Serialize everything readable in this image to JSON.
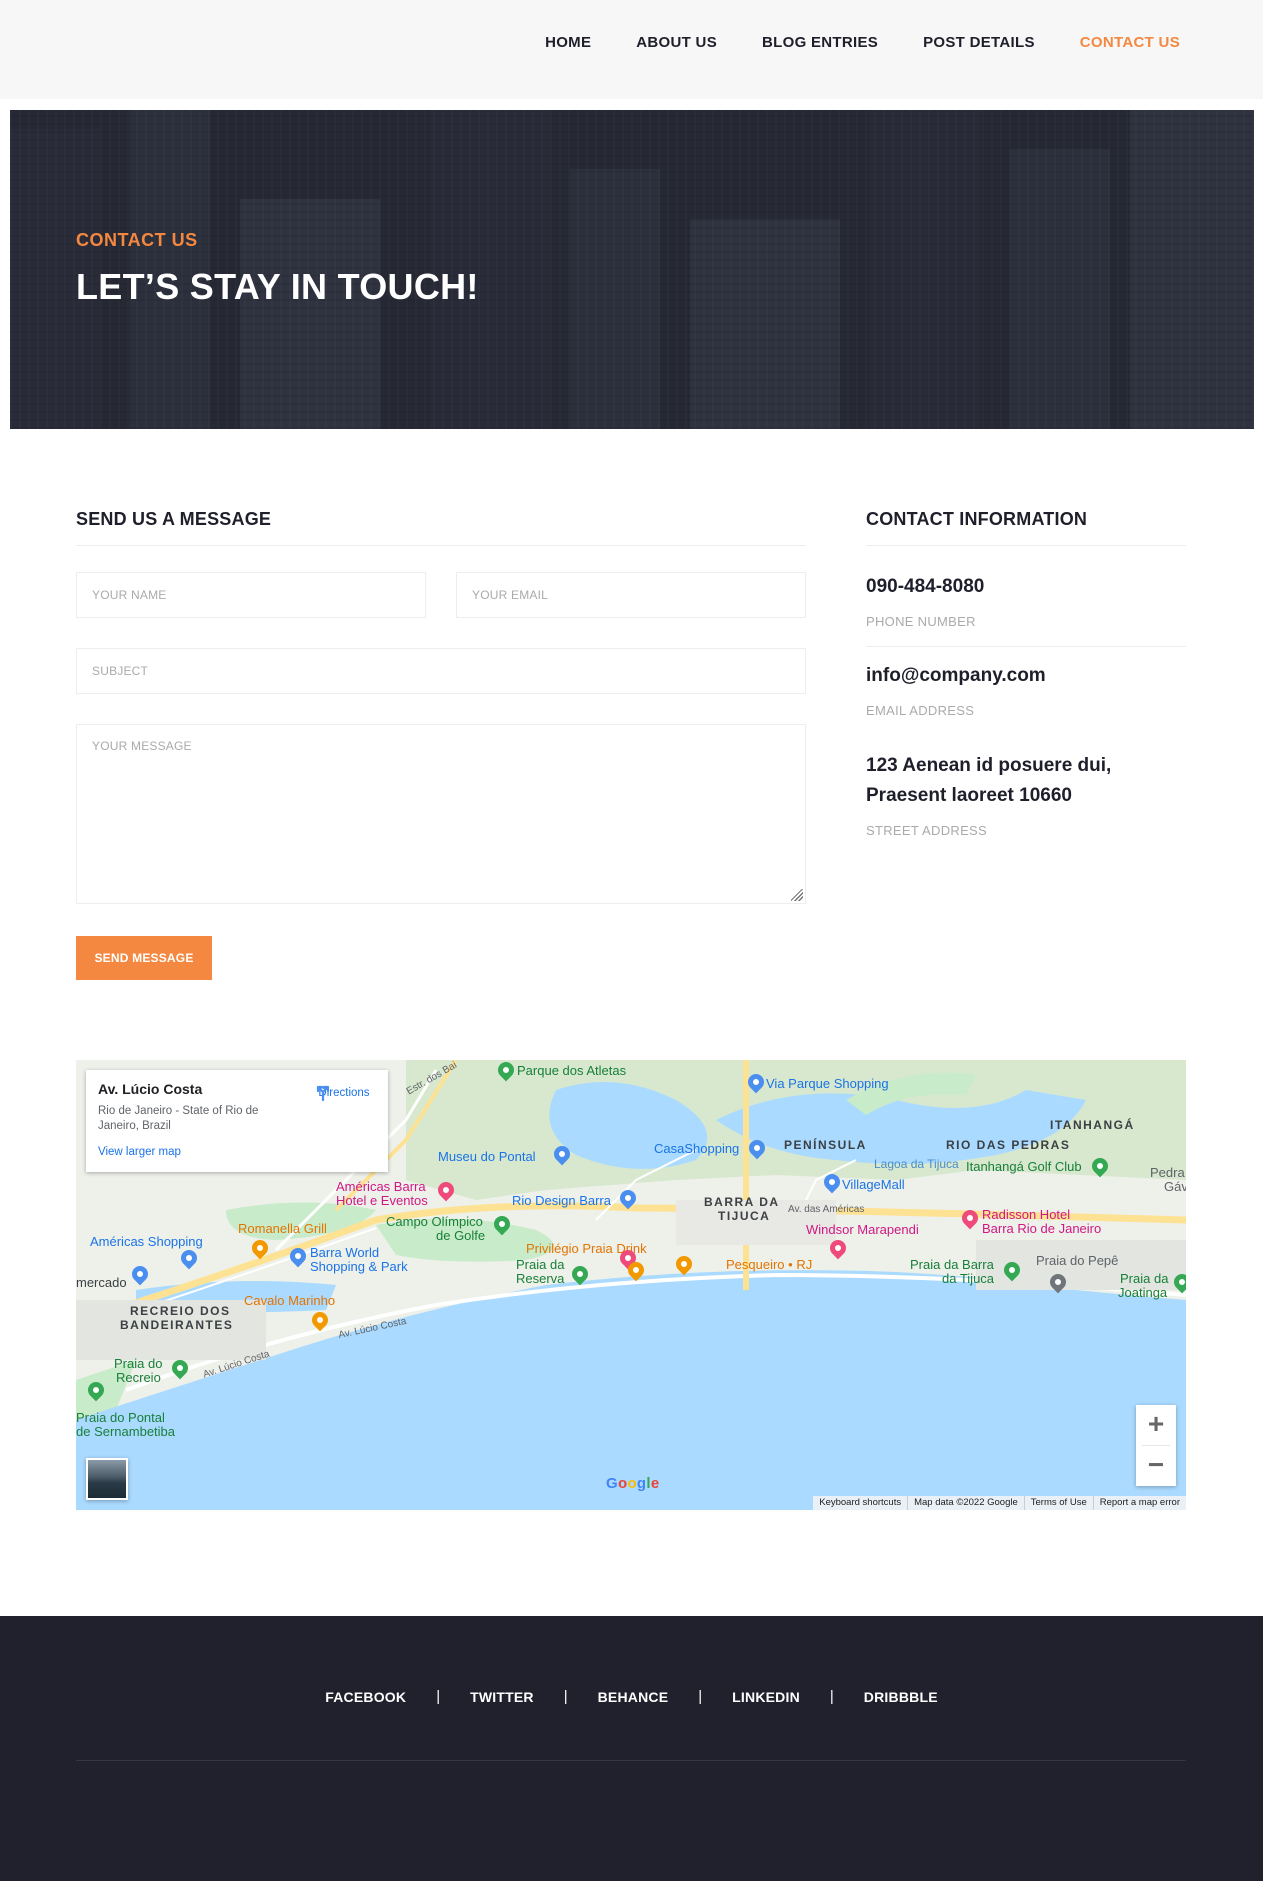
{
  "nav": {
    "items": [
      {
        "label": "HOME",
        "active": false
      },
      {
        "label": "ABOUT US",
        "active": false
      },
      {
        "label": "BLOG ENTRIES",
        "active": false
      },
      {
        "label": "POST DETAILS",
        "active": false
      },
      {
        "label": "CONTACT US",
        "active": true
      }
    ]
  },
  "hero": {
    "eyebrow": "CONTACT US",
    "title": "LET’S STAY IN TOUCH!"
  },
  "form": {
    "title": "SEND US A MESSAGE",
    "name_placeholder": "YOUR NAME",
    "email_placeholder": "YOUR EMAIL",
    "subject_placeholder": "SUBJECT",
    "message_placeholder": "YOUR MESSAGE",
    "submit_label": "SEND MESSAGE"
  },
  "contact_info": {
    "title": "CONTACT INFORMATION",
    "phone": "090-484-8080",
    "phone_label": "PHONE NUMBER",
    "email": "info@company.com",
    "email_label": "EMAIL ADDRESS",
    "address_line1": "123 Aenean id posuere dui,",
    "address_line2": "Praesent laoreet 10660",
    "address_label": "STREET ADDRESS"
  },
  "map": {
    "place_title": "Av. Lúcio Costa",
    "place_subtitle": "Rio de Janeiro - State of Rio de Janeiro, Brazil",
    "view_larger": "View larger map",
    "directions": "Directions",
    "labels": {
      "parque_atletas": "Parque dos Atletas",
      "via_parque": "Via Parque Shopping",
      "itanhanga": "ITANHANGÁ",
      "peninsula": "PENÍNSULA",
      "rio_das_pedras": "RIO DAS PEDRAS",
      "museu": "Museu do Pontal",
      "casashopping": "CasaShopping",
      "lagoa": "Lagoa da Tijuca",
      "itanhanga_golf": "Itanhangá Golf Club",
      "pedra_gav_1": "Pedra",
      "pedra_gav_2": "Gáv",
      "villagemall": "VillageMall",
      "americas_barra_1": "Américas Barra",
      "americas_barra_2": "Hotel e Eventos",
      "rio_design": "Rio Design Barra",
      "barra_tijuca_1": "BARRA DA",
      "barra_tijuca_2": "TIJUCA",
      "av_americas": "Av. das Américas",
      "radisson_1": "Radisson Hotel",
      "radisson_2": "Barra Rio de Janeiro",
      "romanella": "Romanella Grill",
      "campo_1": "Campo Olímpico",
      "campo_2": "de Golfe",
      "windsor": "Windsor Marapendi",
      "americas_shopping": "Américas Shopping",
      "barra_world_1": "Barra World",
      "barra_world_2": "Shopping & Park",
      "privilegio": "Privilégio Praia Drink",
      "praia_reserva_1": "Praia da",
      "praia_reserva_2": "Reserva",
      "pesqueiro": "Pesqueiro • RJ",
      "praia_barra_1": "Praia da Barra",
      "praia_barra_2": "da Tijuca",
      "praia_pepe": "Praia do Pepê",
      "praia_joatinga_1": "Praia da",
      "praia_joatinga_2": "Joatinga",
      "mercado": "mercado",
      "recreio_b_1": "RECREIO DOS",
      "recreio_b_2": "BANDEIRANTES",
      "cavalo": "Cavalo Marinho",
      "av_lucio_1": "Av. Lúcio Costa",
      "av_lucio_2": "Av. Lúcio Costa",
      "praia_recreio_1": "Praia do",
      "praia_recreio_2": "Recreio",
      "praia_pontal_1": "Praia do Pontal",
      "praia_pontal_2": "de Sernambetiba",
      "estr_bai": "Estr. dos Bai"
    },
    "zoom_in": "+",
    "zoom_out": "−",
    "google": "Google",
    "attribution": [
      "Keyboard shortcuts",
      "Map data ©2022 Google",
      "Terms of Use",
      "Report a map error"
    ],
    "colors": {
      "water": "#aadaff",
      "land": "#eef0ea",
      "park": "#c8ebc9",
      "road_major": "#fde293"
    }
  },
  "footer": {
    "social": [
      "FACEBOOK",
      "TWITTER",
      "BEHANCE",
      "LINKEDIN",
      "DRIBBBLE"
    ],
    "separator": "|"
  },
  "colors": {
    "accent": "#f48840",
    "dark": "#1e1f2b",
    "footer_bg": "#20212d"
  }
}
